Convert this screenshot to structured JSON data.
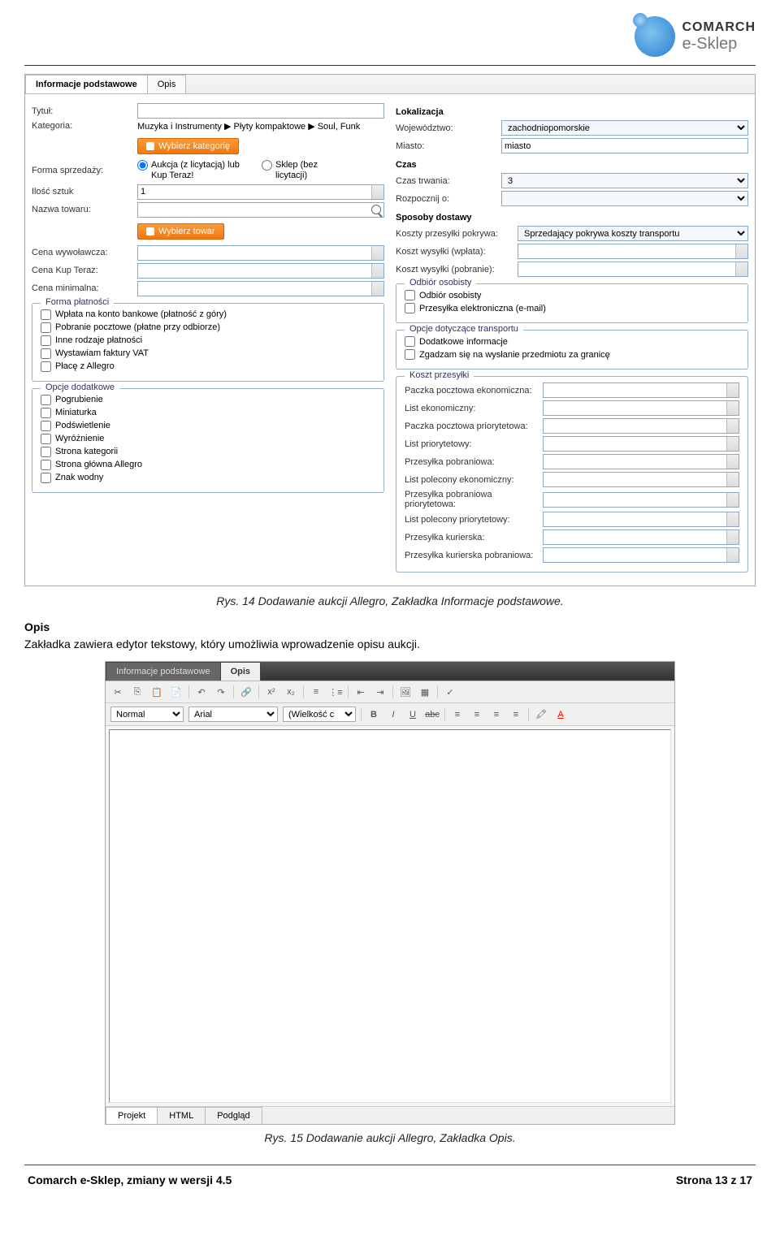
{
  "brand": {
    "line1": "COMARCH",
    "line2": "e-Sklep"
  },
  "screenshot1": {
    "tab_info": "Informacje podstawowe",
    "tab_opis": "Opis",
    "left": {
      "tytul_lbl": "Tytuł:",
      "kategoria_lbl": "Kategoria:",
      "kategoria_val": "Muzyka i Instrumenty ▶ Płyty kompaktowe ▶ Soul, Funk",
      "btn_kategoria": "Wybierz kategorię",
      "forma_lbl": "Forma sprzedaży:",
      "radio1": "Aukcja (z licytacją) lub Kup Teraz!",
      "radio2": "Sklep (bez licytacji)",
      "ilosc_lbl": "Ilość sztuk",
      "ilosc_val": "1",
      "nazwa_lbl": "Nazwa towaru:",
      "btn_towar": "Wybierz towar",
      "cena_wyw_lbl": "Cena wywoławcza:",
      "cena_kup_lbl": "Cena Kup Teraz:",
      "cena_min_lbl": "Cena minimalna:",
      "fs_platnosc": "Forma płatności",
      "chk_p1": "Wpłata na konto bankowe (płatność z góry)",
      "chk_p2": "Pobranie pocztowe (płatne przy odbiorze)",
      "chk_p3": "Inne rodzaje płatności",
      "chk_p4": "Wystawiam faktury VAT",
      "chk_p5": "Płacę z Allegro",
      "fs_opcje": "Opcje dodatkowe",
      "chk_o1": "Pogrubienie",
      "chk_o2": "Miniaturka",
      "chk_o3": "Podświetlenie",
      "chk_o4": "Wyróżnienie",
      "chk_o5": "Strona kategorii",
      "chk_o6": "Strona główna Allegro",
      "chk_o7": "Znak wodny"
    },
    "right": {
      "lokalizacja_h": "Lokalizacja",
      "woj_lbl": "Województwo:",
      "woj_val": "zachodniopomorskie",
      "miasto_lbl": "Miasto:",
      "miasto_val": "miasto",
      "czas_h": "Czas",
      "czas_lbl": "Czas trwania:",
      "czas_val": "3",
      "rozp_lbl": "Rozpocznij o:",
      "dostawa_h": "Sposoby dostawy",
      "koszty_lbl": "Koszty przesyłki pokrywa:",
      "koszty_val": "Sprzedający pokrywa koszty transportu",
      "kw_wplata_lbl": "Koszt wysyłki (wpłata):",
      "kw_pobranie_lbl": "Koszt wysyłki (pobranie):",
      "fs_odbior": "Odbiór osobisty",
      "chk_od1": "Odbiór osobisty",
      "chk_od2": "Przesyłka elektroniczna (e-mail)",
      "fs_transport": "Opcje dotyczące transportu",
      "chk_t1": "Dodatkowe informacje",
      "chk_t2": "Zgadzam się na wysłanie przedmiotu za granicę",
      "fs_koszt": "Koszt przesyłki",
      "k1": "Paczka pocztowa ekonomiczna:",
      "k2": "List ekonomiczny:",
      "k3": "Paczka pocztowa priorytetowa:",
      "k4": "List priorytetowy:",
      "k5": "Przesyłka pobraniowa:",
      "k6": "List polecony ekonomiczny:",
      "k7": "Przesyłka pobraniowa priorytetowa:",
      "k8": "List polecony priorytetowy:",
      "k9": "Przesyłka kurierska:",
      "k10": "Przesyłka kurierska pobraniowa:"
    }
  },
  "caption1": "Rys. 14 Dodawanie aukcji Allegro, Zakładka Informacje podstawowe.",
  "opis_heading": "Opis",
  "opis_text": "Zakładka zawiera edytor tekstowy, który umożliwia wprowadzenie opisu aukcji.",
  "screenshot2": {
    "tab_info": "Informacje podstawowe",
    "tab_opis": "Opis",
    "sel_style": "Normal",
    "sel_font": "Arial",
    "sel_size": "(Wielkość c",
    "btab1": "Projekt",
    "btab2": "HTML",
    "btab3": "Podgląd"
  },
  "caption2": "Rys. 15 Dodawanie aukcji Allegro, Zakładka Opis.",
  "footer_left": "Comarch e-Sklep, zmiany w wersji 4.5",
  "footer_right": "Strona 13 z 17"
}
